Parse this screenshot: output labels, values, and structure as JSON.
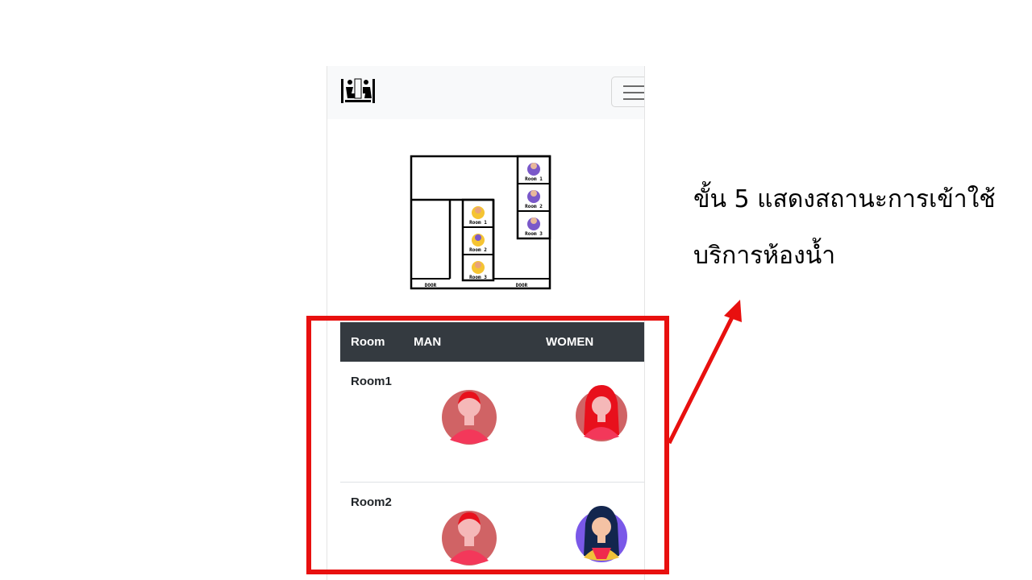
{
  "phone": {
    "navbar": {
      "brand_icon": "restroom-logo-icon",
      "menu_icon": "hamburger-menu-icon"
    },
    "floorplan": {
      "rooms_right": [
        "Room 1",
        "Room 2",
        "Room 3"
      ],
      "rooms_left": [
        "Room 1",
        "Room 2",
        "Room 3"
      ],
      "doors": [
        "DOOR",
        "DOOR"
      ]
    },
    "table": {
      "headers": {
        "room": "Room",
        "man": "MAN",
        "women": "WOMEN"
      },
      "rows": [
        {
          "room": "Room1",
          "man_status": "occupied",
          "women_status": "occupied"
        },
        {
          "room": "Room2",
          "man_status": "occupied",
          "women_status": "available"
        }
      ]
    }
  },
  "annotation": {
    "line1": "ขั้น 5 แสดงสถานะการเข้าใช้",
    "line2": "บริการห้องน้ำ",
    "highlight_color": "#e8100f"
  }
}
